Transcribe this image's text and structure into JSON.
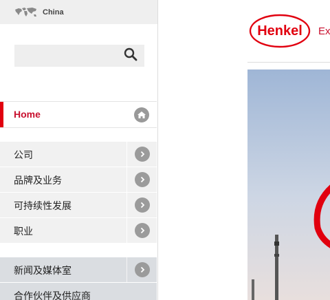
{
  "header": {
    "country": "China",
    "globe_icon": "globe-map-icon"
  },
  "search": {
    "value": "",
    "placeholder": "",
    "icon": "search-icon"
  },
  "home": {
    "label": "Home",
    "icon": "home-icon",
    "accent": "#e1000f"
  },
  "nav": {
    "group1": [
      {
        "label": "公司"
      },
      {
        "label": "品牌及业务"
      },
      {
        "label": "可持续性发展"
      },
      {
        "label": "职业"
      }
    ],
    "group2": [
      {
        "label": "新闻及媒体室"
      },
      {
        "label": "合作伙伴及供应商"
      }
    ]
  },
  "toggle": {
    "icon": "chevron-right-icon"
  },
  "brand": {
    "logo_text": "Henkel",
    "tagline": "Ex",
    "color": "#e1000f"
  }
}
